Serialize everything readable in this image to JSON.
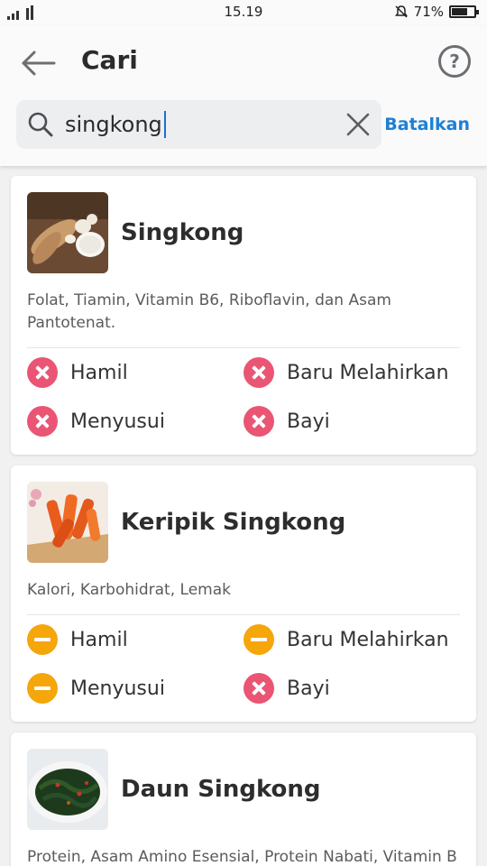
{
  "status_bar": {
    "time": "15.19",
    "battery": "71%",
    "battery_level": 0.71
  },
  "header": {
    "title": "Cari",
    "help_symbol": "?"
  },
  "search": {
    "value": "singkong",
    "cancel_label": "Batalkan"
  },
  "colors": {
    "accent": "#1c7fd6",
    "not_allowed": "#ea5574",
    "caution": "#f5a60b"
  },
  "results": [
    {
      "name": "Singkong",
      "nutrients": "Folat, Tiamin, Vitamin B6, Riboflavin, dan Asam Pantotenat.",
      "statuses": [
        {
          "label": "Hamil",
          "level": "no"
        },
        {
          "label": "Baru Melahirkan",
          "level": "no"
        },
        {
          "label": "Menyusui",
          "level": "no"
        },
        {
          "label": "Bayi",
          "level": "no"
        }
      ]
    },
    {
      "name": "Keripik Singkong",
      "nutrients": "Kalori, Karbohidrat, Lemak",
      "statuses": [
        {
          "label": "Hamil",
          "level": "caution"
        },
        {
          "label": "Baru Melahirkan",
          "level": "caution"
        },
        {
          "label": "Menyusui",
          "level": "caution"
        },
        {
          "label": "Bayi",
          "level": "no"
        }
      ]
    },
    {
      "name": "Daun Singkong",
      "nutrients": "Protein, Asam Amino Esensial, Protein Nabati, Vitamin B",
      "statuses": []
    }
  ]
}
